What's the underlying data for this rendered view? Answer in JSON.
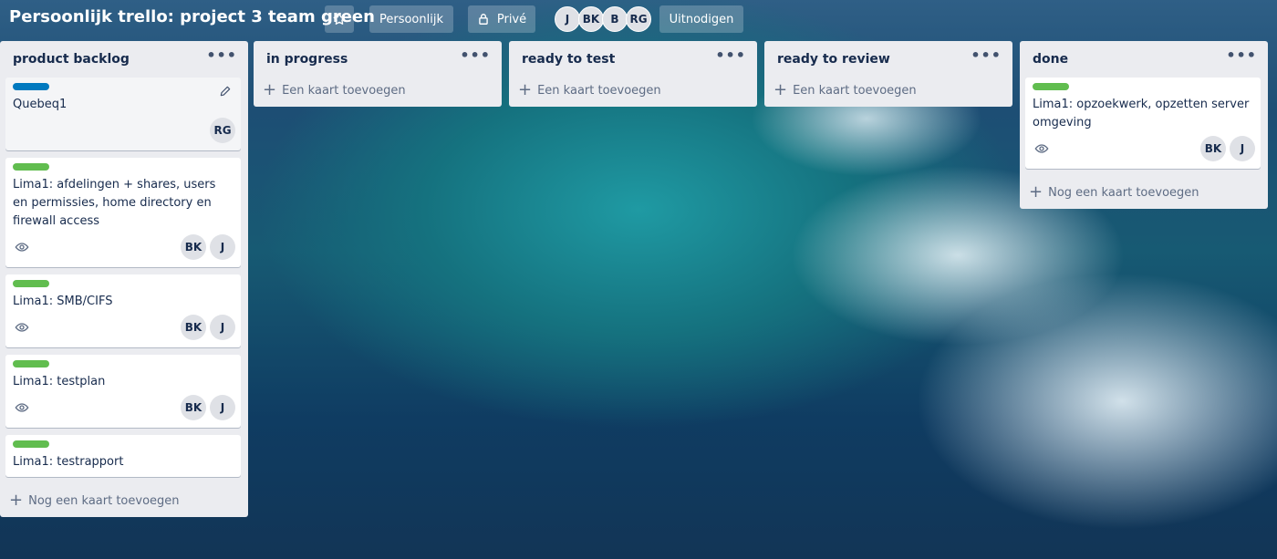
{
  "header": {
    "title": "Persoonlijk trello: project 3 team green",
    "team_label": "Persoonlijk",
    "visibility_label": "Privé",
    "invite_label": "Uitnodigen",
    "members": [
      "J",
      "BK",
      "B",
      "RG"
    ]
  },
  "colors": {
    "green_label": "#61bd4f",
    "blue_label": "#0079bf"
  },
  "lists": [
    {
      "name": "product backlog",
      "cards": [
        {
          "title": "Quebeq1",
          "label": "blue",
          "members": [
            "RG"
          ],
          "watch": false
        },
        {
          "title": "Lima1: afdelingen + shares, users en permissies, home directory en firewall access",
          "label": "green",
          "members": [
            "BK",
            "J"
          ],
          "watch": true
        },
        {
          "title": "Lima1: SMB/CIFS",
          "label": "green",
          "members": [
            "BK",
            "J"
          ],
          "watch": true
        },
        {
          "title": "Lima1: testplan",
          "label": "green",
          "members": [
            "BK",
            "J"
          ],
          "watch": true
        },
        {
          "title": "Lima1: testrapport",
          "label": "green",
          "members": [],
          "watch": false
        }
      ],
      "add_label": "Nog een kaart toevoegen"
    },
    {
      "name": "in progress",
      "cards": [],
      "add_label": "Een kaart toevoegen"
    },
    {
      "name": "ready to test",
      "cards": [],
      "add_label": "Een kaart toevoegen"
    },
    {
      "name": "ready to review",
      "cards": [],
      "add_label": "Een kaart toevoegen"
    },
    {
      "name": "done",
      "cards": [
        {
          "title": "Lima1: opzoekwerk, opzetten server omgeving",
          "label": "green",
          "members": [
            "BK",
            "J"
          ],
          "watch": true
        }
      ],
      "add_label": "Nog een kaart toevoegen"
    }
  ]
}
